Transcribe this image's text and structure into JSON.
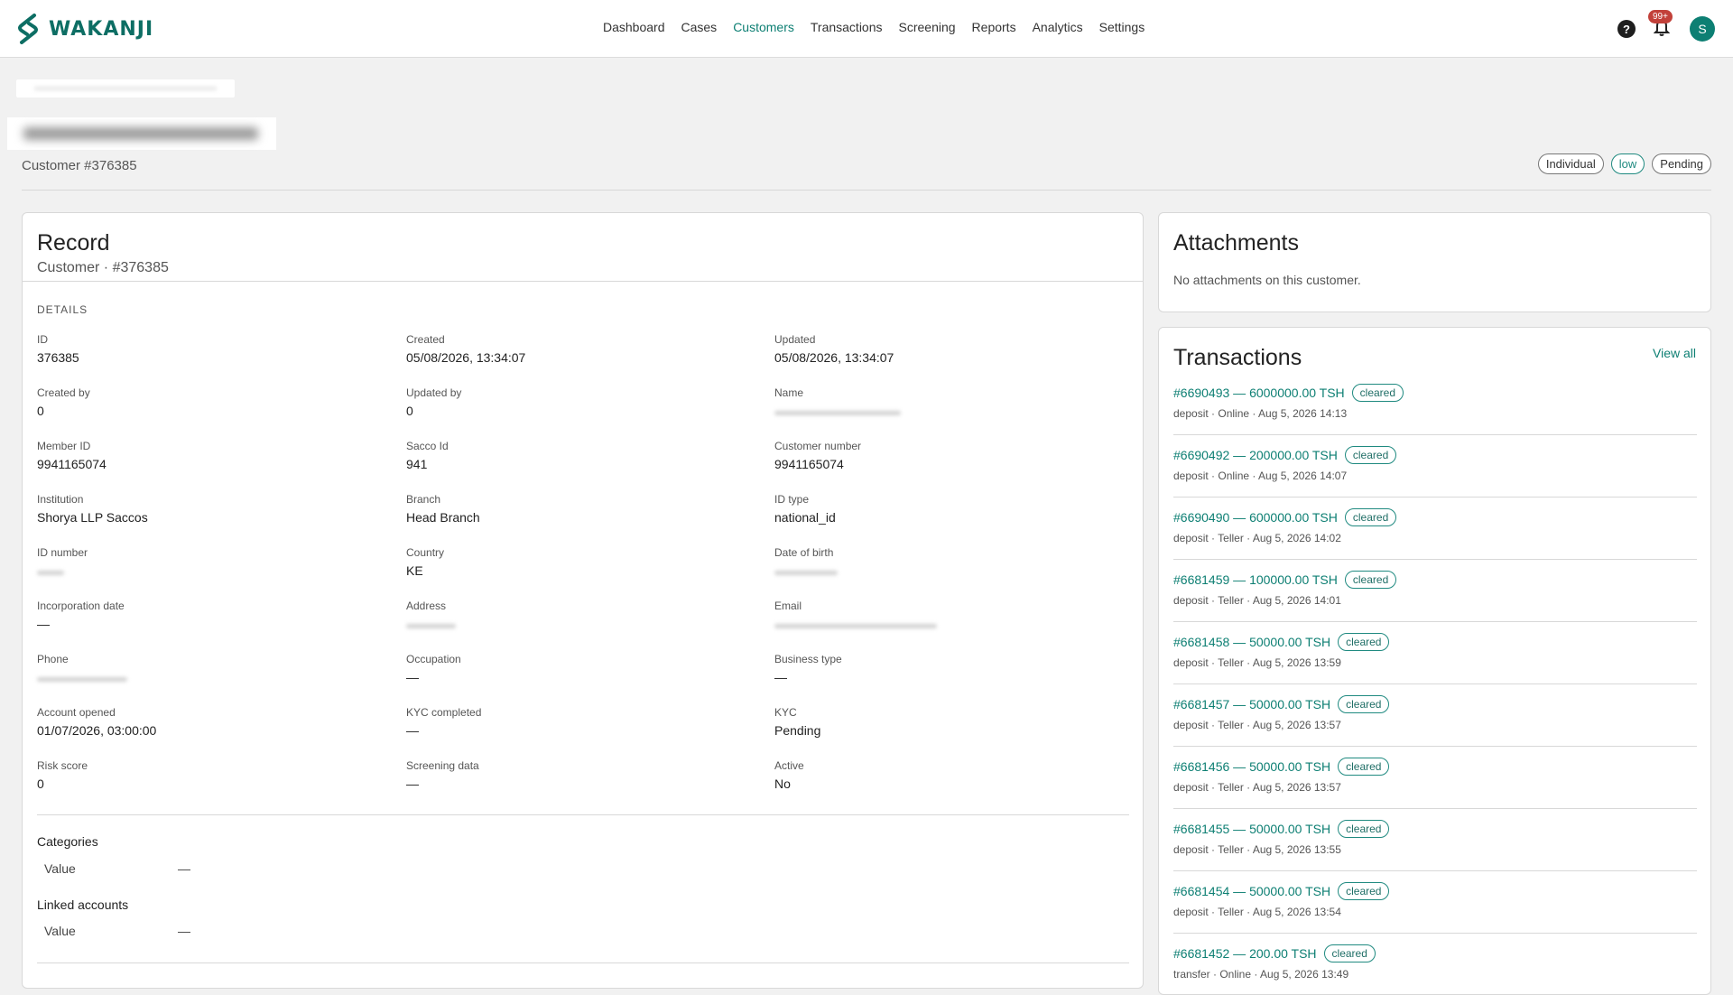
{
  "header": {
    "brand": "WAKANJI",
    "nav": [
      "Dashboard",
      "Cases",
      "Customers",
      "Transactions",
      "Screening",
      "Reports",
      "Analytics",
      "Settings"
    ],
    "active_nav": "Customers",
    "help_icon": "?",
    "notifications_badge": "99+",
    "avatar_initial": "S"
  },
  "page": {
    "subtitle": "Customer #376385",
    "tags": [
      "Individual",
      "low",
      "Pending"
    ]
  },
  "record": {
    "title": "Record",
    "subtitle": "Customer · #376385",
    "details_label": "DETAILS",
    "fields": [
      {
        "label": "ID",
        "value": "376385"
      },
      {
        "label": "Created",
        "value": "05/08/2026, 13:34:07"
      },
      {
        "label": "Updated",
        "value": "05/08/2026, 13:34:07"
      },
      {
        "label": "Created by",
        "value": "0"
      },
      {
        "label": "Updated by",
        "value": "0"
      },
      {
        "label": "Name",
        "value": ""
      },
      {
        "label": "Member ID",
        "value": "9941165074"
      },
      {
        "label": "Sacco Id",
        "value": "941"
      },
      {
        "label": "Customer number",
        "value": "9941165074"
      },
      {
        "label": "Institution",
        "value": "Shorya LLP Saccos"
      },
      {
        "label": "Branch",
        "value": "Head Branch"
      },
      {
        "label": "ID type",
        "value": "national_id"
      },
      {
        "label": "ID number",
        "value": ""
      },
      {
        "label": "Country",
        "value": "KE"
      },
      {
        "label": "Date of birth",
        "value": ""
      },
      {
        "label": "Incorporation date",
        "value": "—"
      },
      {
        "label": "Address",
        "value": ""
      },
      {
        "label": "Email",
        "value": ""
      },
      {
        "label": "Phone",
        "value": ""
      },
      {
        "label": "Occupation",
        "value": "—"
      },
      {
        "label": "Business type",
        "value": "—"
      },
      {
        "label": "Account opened",
        "value": "01/07/2026, 03:00:00"
      },
      {
        "label": "KYC completed",
        "value": "—"
      },
      {
        "label": "KYC",
        "value": "Pending"
      },
      {
        "label": "Risk score",
        "value": "0"
      },
      {
        "label": "Screening data",
        "value": "—"
      },
      {
        "label": "Active",
        "value": "No"
      }
    ],
    "categories": {
      "title": "Categories",
      "row_label": "Value",
      "row_value": "—"
    },
    "linked": {
      "title": "Linked accounts",
      "row_label": "Value",
      "row_value": "—"
    }
  },
  "attachments": {
    "title": "Attachments",
    "empty": "No attachments on this customer."
  },
  "transactions": {
    "title": "Transactions",
    "view_all": "View all",
    "items": [
      {
        "head": "#6690493 — 6000000.00 TSH",
        "status": "cleared",
        "meta": "deposit · Online · Aug 5, 2026 14:13"
      },
      {
        "head": "#6690492 — 200000.00 TSH",
        "status": "cleared",
        "meta": "deposit · Online · Aug 5, 2026 14:07"
      },
      {
        "head": "#6690490 — 600000.00 TSH",
        "status": "cleared",
        "meta": "deposit · Teller · Aug 5, 2026 14:02"
      },
      {
        "head": "#6681459 — 100000.00 TSH",
        "status": "cleared",
        "meta": "deposit · Teller · Aug 5, 2026 14:01"
      },
      {
        "head": "#6681458 — 50000.00 TSH",
        "status": "cleared",
        "meta": "deposit · Teller · Aug 5, 2026 13:59"
      },
      {
        "head": "#6681457 — 50000.00 TSH",
        "status": "cleared",
        "meta": "deposit · Teller · Aug 5, 2026 13:57"
      },
      {
        "head": "#6681456 — 50000.00 TSH",
        "status": "cleared",
        "meta": "deposit · Teller · Aug 5, 2026 13:57"
      },
      {
        "head": "#6681455 — 50000.00 TSH",
        "status": "cleared",
        "meta": "deposit · Teller · Aug 5, 2026 13:55"
      },
      {
        "head": "#6681454 — 50000.00 TSH",
        "status": "cleared",
        "meta": "deposit · Teller · Aug 5, 2026 13:54"
      },
      {
        "head": "#6681452 — 200.00 TSH",
        "status": "cleared",
        "meta": "transfer · Online · Aug 5, 2026 13:49"
      }
    ]
  }
}
